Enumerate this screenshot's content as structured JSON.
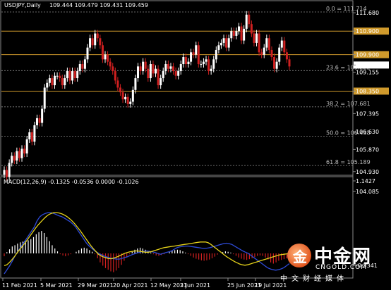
{
  "chart_data": {
    "type": "candlestick",
    "title": "USDJPY,Daily",
    "ohlc_text": "109.444 109.479 109.431 109.459",
    "price_ylim": [
      103.6,
      112.1
    ],
    "price_axis_ticks": [
      "111.680",
      "110.900",
      "109.900",
      "109.459",
      "109.155",
      "108.350",
      "107.395",
      "106.630",
      "105.870",
      "104.930",
      "104.085"
    ],
    "current_price": "109.459",
    "horizontal_levels": [
      {
        "price": 110.9,
        "label": "110.900",
        "color": "#d09a2c"
      },
      {
        "price": 109.9,
        "label": "109.900",
        "color": "#d09a2c"
      },
      {
        "price": 108.35,
        "label": "108.350",
        "color": "#d09a2c"
      }
    ],
    "fib_levels": [
      {
        "price": 111.714,
        "label": "0.0 = 111.714"
      },
      {
        "price": 109.222,
        "label": "23.6 = 109.222"
      },
      {
        "price": 107.681,
        "label": "38.2 = 107.681"
      },
      {
        "price": 106.435,
        "label": "50.0 = 106.435"
      },
      {
        "price": 105.189,
        "label": "61.8 = 105.189"
      }
    ],
    "x_labels": [
      "11 Feb 2021",
      "5 Mar 2021",
      "29 Mar 2021",
      "20 Apr 2021",
      "12 May 2021",
      "3 Jun 2021",
      "25 Jun 2021",
      "19 Jul 2021"
    ],
    "closes": [
      105.0,
      104.7,
      105.3,
      105.6,
      105.4,
      105.8,
      105.5,
      105.9,
      105.7,
      106.3,
      106.6,
      106.2,
      106.9,
      107.2,
      107.0,
      107.6,
      108.5,
      108.7,
      108.9,
      108.6,
      109.0,
      109.0,
      108.9,
      108.6,
      108.9,
      109.2,
      108.8,
      109.2,
      108.9,
      109.2,
      109.5,
      109.3,
      109.7,
      110.2,
      110.6,
      110.3,
      110.8,
      110.6,
      110.3,
      109.7,
      109.9,
      109.6,
      109.4,
      109.2,
      108.8,
      108.5,
      108.3,
      108.0,
      108.1,
      107.8,
      107.9,
      108.4,
      108.9,
      109.4,
      109.2,
      109.6,
      109.3,
      108.9,
      109.5,
      109.1,
      109.3,
      108.6,
      108.9,
      109.2,
      109.5,
      109.3,
      109.4,
      109.2,
      109.0,
      109.2,
      109.5,
      109.8,
      109.5,
      109.6,
      110.0,
      109.9,
      110.3,
      109.5,
      109.5,
      109.6,
      109.7,
      109.2,
      109.3,
      109.7,
      110.1,
      110.3,
      110.4,
      110.6,
      110.2,
      110.6,
      110.9,
      110.7,
      110.9,
      111.1,
      110.5,
      111.0,
      111.6,
      111.2,
      110.8,
      110.4,
      110.8,
      110.0,
      109.9,
      110.2,
      110.6,
      110.1,
      109.8,
      109.3,
      109.6,
      110.2,
      110.5,
      110.0,
      109.7,
      109.4
    ],
    "macd_label": "MACD(12,26,9) -0.1325 -0.0536 0.0000 -0.1026",
    "macd_axis_ticks": [
      "1.1427",
      "-0.5341"
    ],
    "macd_ylim": [
      -0.6,
      1.2
    ],
    "macd_hist": [
      -0.07,
      0.03,
      0.1,
      0.17,
      0.2,
      0.24,
      0.27,
      0.29,
      0.3,
      0.32,
      0.35,
      0.4,
      0.47,
      0.52,
      0.55,
      0.5,
      0.4,
      0.3,
      0.2,
      0.12,
      0.05,
      -0.02,
      -0.05,
      -0.07,
      -0.05,
      -0.02,
      0.0,
      0.04,
      0.08,
      0.12,
      0.14,
      0.12,
      0.08,
      0.04,
      -0.02,
      -0.12,
      -0.22,
      -0.3,
      -0.36,
      -0.4,
      -0.44,
      -0.46,
      -0.42,
      -0.36,
      -0.28,
      -0.18,
      -0.1,
      -0.02,
      0.04,
      0.09,
      0.12,
      0.14,
      0.12,
      0.09,
      0.05,
      0.02,
      -0.02,
      -0.05,
      -0.06,
      -0.04,
      -0.02,
      0.0,
      0.03,
      0.06,
      0.08,
      0.09,
      0.08,
      0.05,
      0.02,
      -0.02,
      -0.06,
      -0.1,
      -0.13,
      -0.15,
      -0.17,
      -0.18,
      -0.17,
      -0.15,
      -0.12,
      -0.08,
      -0.03,
      0.0,
      0.03,
      0.05,
      0.04,
      0.02,
      -0.02,
      -0.06,
      -0.1,
      -0.13,
      -0.15,
      -0.16,
      -0.14,
      -0.12,
      -0.09,
      -0.06,
      -0.05,
      -0.06,
      -0.1,
      -0.15,
      -0.22,
      -0.25,
      -0.22,
      -0.18,
      -0.16,
      -0.14,
      -0.12,
      -0.1
    ],
    "macd_main": [
      -0.5,
      -0.4,
      -0.3,
      -0.18,
      -0.05,
      0.05,
      0.15,
      0.25,
      0.35,
      0.45,
      0.55,
      0.65,
      0.8,
      0.9,
      0.95,
      0.98,
      1.0,
      1.0,
      0.98,
      0.95,
      0.92,
      0.9,
      0.86,
      0.82,
      0.78,
      0.72,
      0.65,
      0.55,
      0.45,
      0.35,
      0.25,
      0.18,
      0.12,
      0.06,
      0.02,
      -0.02,
      -0.05,
      -0.08,
      -0.1,
      -0.12,
      -0.13,
      -0.14,
      -0.14,
      -0.12,
      -0.1,
      -0.08,
      -0.05,
      -0.02,
      0.0,
      0.02,
      0.04,
      0.05,
      0.06,
      0.05,
      0.04,
      0.02,
      0.0,
      -0.02,
      0.0,
      0.02,
      0.04,
      0.06,
      0.1,
      0.14,
      0.16,
      0.17,
      0.18,
      0.18,
      0.17,
      0.16,
      0.15,
      0.14,
      0.13,
      0.12,
      0.13,
      0.14,
      0.16,
      0.18,
      0.2,
      0.22,
      0.24,
      0.25,
      0.24,
      0.22,
      0.18,
      0.14,
      0.1,
      0.06,
      0.03,
      0.0,
      -0.05,
      -0.1,
      -0.15,
      -0.2,
      -0.25,
      -0.3,
      -0.35,
      -0.38,
      -0.4,
      -0.41,
      -0.4,
      -0.38,
      -0.35,
      -0.3,
      -0.25
    ],
    "macd_signal": [
      -0.3,
      -0.28,
      -0.22,
      -0.15,
      -0.07,
      0.02,
      0.1,
      0.18,
      0.26,
      0.35,
      0.44,
      0.53,
      0.62,
      0.7,
      0.77,
      0.84,
      0.9,
      0.95,
      0.98,
      1.0,
      1.0,
      0.99,
      0.97,
      0.94,
      0.9,
      0.85,
      0.79,
      0.72,
      0.64,
      0.56,
      0.47,
      0.38,
      0.29,
      0.2,
      0.12,
      0.05,
      -0.02,
      -0.06,
      -0.09,
      -0.11,
      -0.13,
      -0.13,
      -0.11,
      -0.09,
      -0.06,
      -0.03,
      0.0,
      0.02,
      0.04,
      0.05,
      0.06,
      0.06,
      0.05,
      0.04,
      0.03,
      0.03,
      0.04,
      0.06,
      0.08,
      0.1,
      0.12,
      0.14,
      0.15,
      0.16,
      0.17,
      0.18,
      0.19,
      0.2,
      0.21,
      0.22,
      0.23,
      0.24,
      0.25,
      0.26,
      0.27,
      0.28,
      0.28,
      0.28,
      0.26,
      0.22,
      0.17,
      0.12,
      0.07,
      0.02,
      -0.03,
      -0.08,
      -0.12,
      -0.16,
      -0.2,
      -0.23,
      -0.26,
      -0.28,
      -0.29,
      -0.28,
      -0.26,
      -0.24,
      -0.22,
      -0.2,
      -0.18,
      -0.16,
      -0.14,
      -0.12,
      -0.1,
      -0.08,
      -0.06,
      -0.04,
      -0.03,
      -0.02,
      -0.01,
      0.0
    ],
    "colors": {
      "bull": "#ffffff",
      "bear": "#d02020",
      "level": "#d09a2c",
      "macd_main": "#2e4bd8",
      "macd_signal": "#e6d31a",
      "current_price_bg": "#ffffff"
    }
  },
  "logo": {
    "symbol": "金",
    "brand": "中金网",
    "domain": "CNGOLD.COM",
    "tagline": "中文财经媒体"
  }
}
